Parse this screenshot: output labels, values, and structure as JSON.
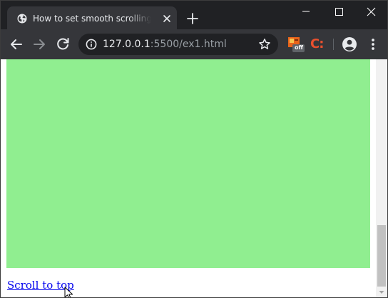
{
  "tab": {
    "title": "How to set smooth scrolling after"
  },
  "omnibox": {
    "url_host": "127.0.0.1",
    "url_rest": ":5500/ex1.html"
  },
  "extensions": {
    "ext1_badge": "off",
    "ext2_letter": "C:"
  },
  "page": {
    "link_text": "Scroll to top",
    "box_color": "#90ee90",
    "link_color": "#0000ee"
  },
  "icons": {
    "favicon": "globe-icon",
    "tab_close": "close-icon",
    "new_tab": "plus-icon",
    "back": "arrow-left-icon",
    "forward": "arrow-right-icon",
    "reload": "reload-icon",
    "site_info": "info-icon",
    "bookmark": "star-icon",
    "profile": "account-circle-icon",
    "menu": "kebab-menu-icon"
  }
}
